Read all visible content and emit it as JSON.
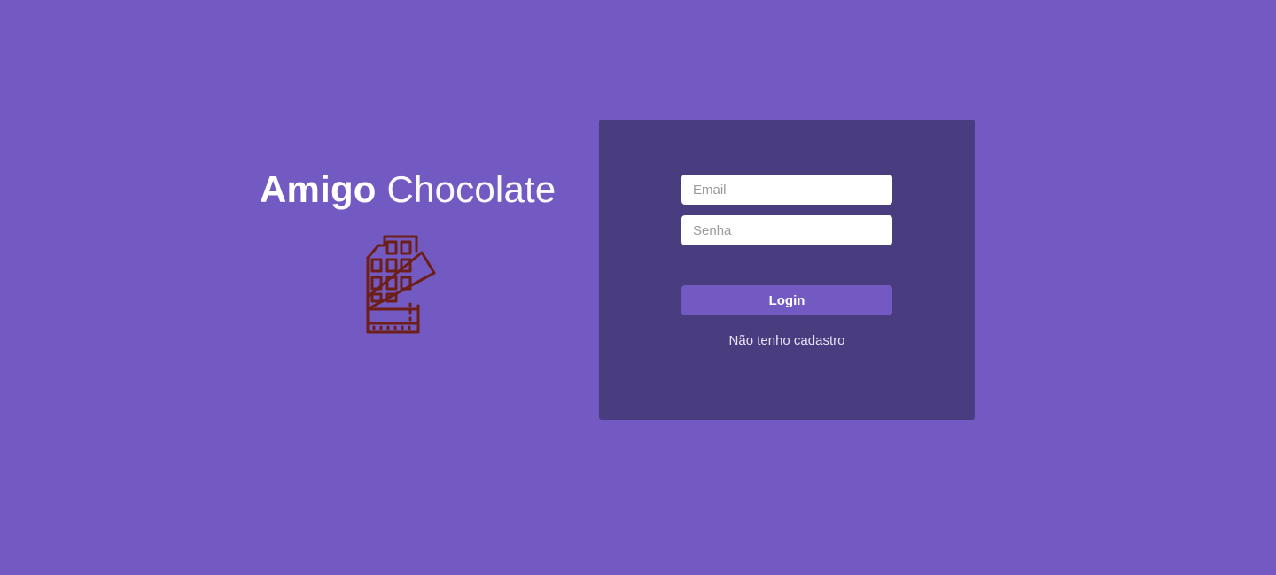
{
  "brand": {
    "title_bold": "Amigo",
    "title_light": "Chocolate",
    "logo_icon": "chocolate-bar-icon",
    "logo_color": "#6b1f16"
  },
  "colors": {
    "background": "#7359c2",
    "panel": "#4a3d7f",
    "button": "#7359c2",
    "text": "#ffffff"
  },
  "login_form": {
    "email_placeholder": "Email",
    "email_value": "",
    "password_placeholder": "Senha",
    "password_value": "",
    "login_label": "Login",
    "signup_link": "Não tenho cadastro"
  }
}
